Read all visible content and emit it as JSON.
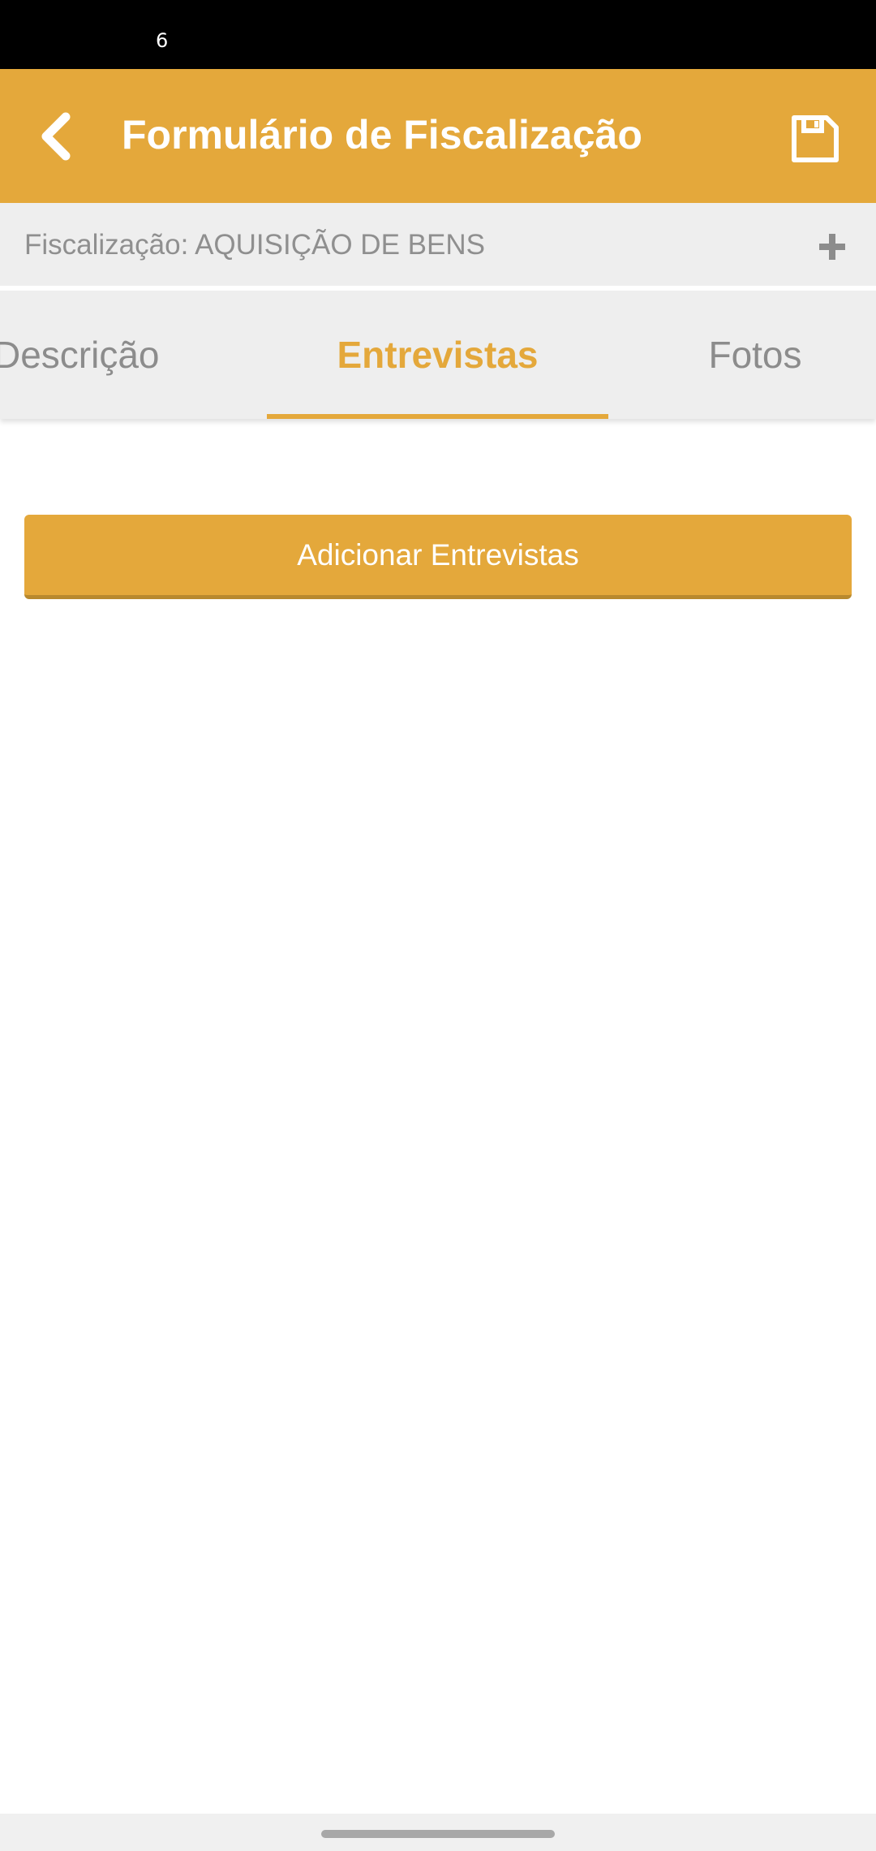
{
  "status_bar": {
    "text": "6"
  },
  "app_bar": {
    "title": "Formulário de Fiscalização",
    "back_icon": "chevron-left-icon",
    "save_icon": "floppy-disk-icon",
    "background_color": "#E4A83B"
  },
  "sub_header": {
    "label": "Fiscalização: AQUISIÇÃO DE BENS",
    "plus_icon": "plus-icon"
  },
  "tabs": [
    {
      "label": "Descrição",
      "selected": false
    },
    {
      "label": "Entrevistas",
      "selected": true
    },
    {
      "label": "Fotos",
      "selected": false
    }
  ],
  "main": {
    "add_button_label": "Adicionar Entrevistas"
  },
  "colors": {
    "accent": "#E4A83B",
    "inactive_text": "#8C8C8C",
    "sub_header_bg": "#EEEEEE"
  }
}
